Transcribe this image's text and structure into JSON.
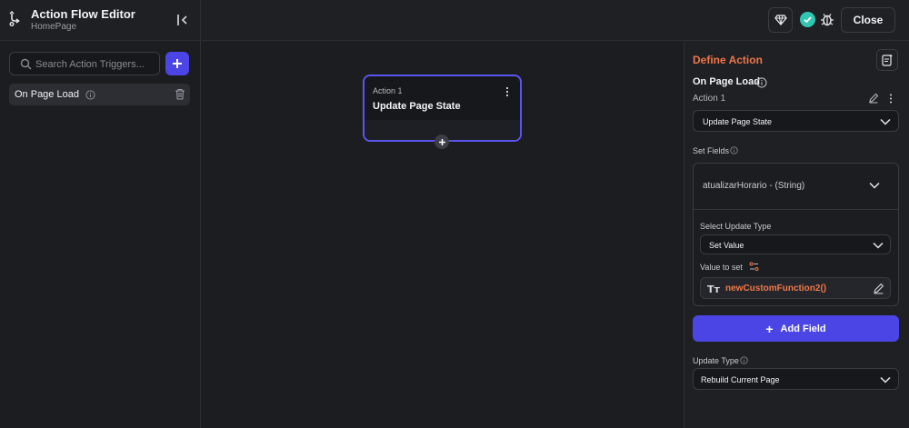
{
  "header": {
    "title": "Action Flow Editor",
    "subtitle": "HomePage",
    "close_label": "Close",
    "status_color": "#31c6b3"
  },
  "left_panel": {
    "search_placeholder": "Search Action Triggers...",
    "triggers": [
      {
        "label": "On Page Load"
      }
    ]
  },
  "canvas": {
    "node": {
      "label": "Action 1",
      "title": "Update Page State"
    }
  },
  "right_panel": {
    "title": "Define Action",
    "trigger_name": "On Page Load",
    "action_label": "Action 1",
    "action_select": "Update Page State",
    "set_fields_label": "Set Fields",
    "field": {
      "name": "atualizarHorario - (String)",
      "update_type_label": "Select Update Type",
      "update_type_value": "Set Value",
      "value_label": "Value to set",
      "value": "newCustomFunction2()"
    },
    "add_field_label": "Add Field",
    "update_type_label": "Update Type",
    "update_type_value": "Rebuild Current Page"
  },
  "colors": {
    "accent": "#4b45e6",
    "highlight": "#f0774a",
    "node_border": "#5b55ef"
  }
}
